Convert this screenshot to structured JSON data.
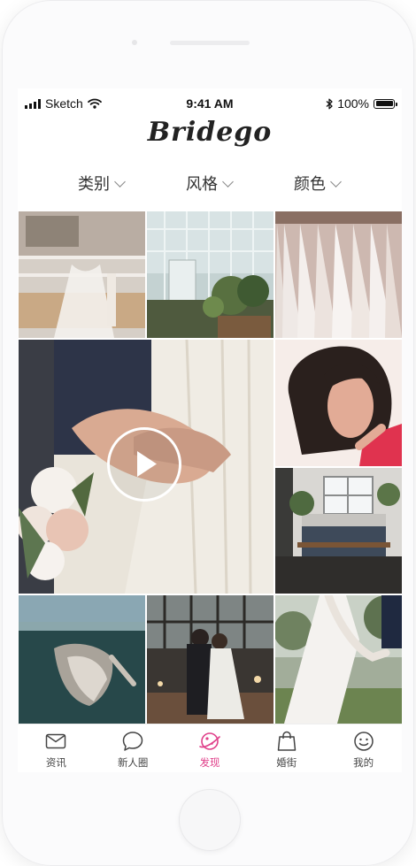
{
  "status_bar": {
    "carrier": "Sketch",
    "time": "9:41 AM",
    "battery": "100%"
  },
  "app": {
    "logo": "Bridego"
  },
  "filters": [
    {
      "label": "类别"
    },
    {
      "label": "风格"
    },
    {
      "label": "颜色"
    }
  ],
  "tab_bar": {
    "items": [
      {
        "label": "资讯",
        "icon": "mail-icon",
        "active": false
      },
      {
        "label": "新人圈",
        "icon": "chat-bubble-icon",
        "active": false
      },
      {
        "label": "发现",
        "icon": "planet-icon",
        "active": true
      },
      {
        "label": "婚街",
        "icon": "shopping-bag-icon",
        "active": false
      },
      {
        "label": "我的",
        "icon": "smiley-icon",
        "active": false
      }
    ],
    "active_color": "#e0408a"
  },
  "gallery": {
    "items": [
      {
        "subject": "dress-boutique-window"
      },
      {
        "subject": "greenhouse"
      },
      {
        "subject": "dress-rack"
      },
      {
        "subject": "couple-holding-hands-video",
        "video": true
      },
      {
        "subject": "curly-hair-woman"
      },
      {
        "subject": "bedroom-interior"
      },
      {
        "subject": "underwater-bride"
      },
      {
        "subject": "couple-dancing"
      },
      {
        "subject": "bride-lace-gown"
      }
    ]
  }
}
